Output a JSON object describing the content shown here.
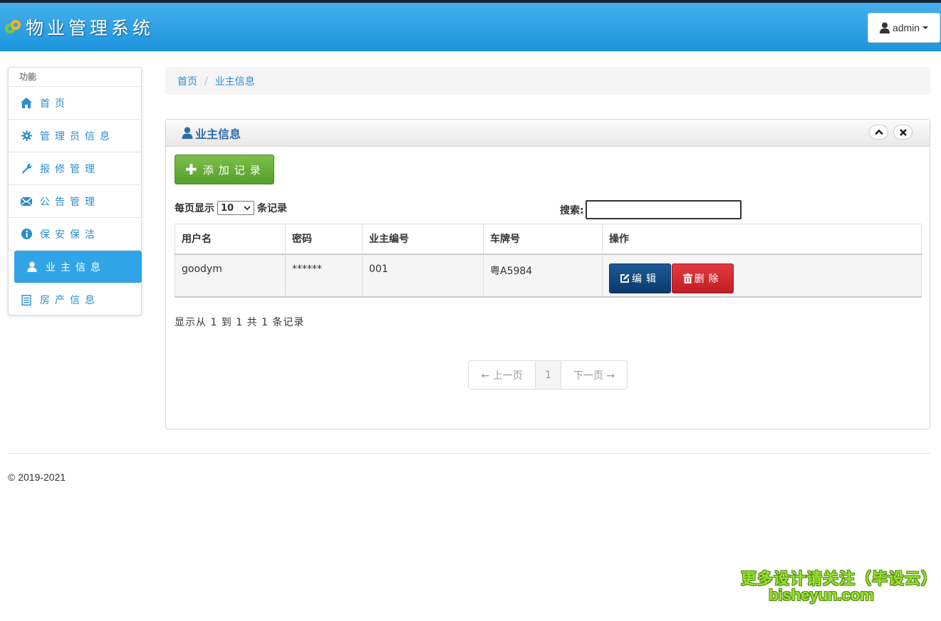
{
  "app": {
    "title": "物业管理系统"
  },
  "user": {
    "name": "admin"
  },
  "sidebar": {
    "header": "功能",
    "items": [
      {
        "label": "首页",
        "icon": "home-icon"
      },
      {
        "label": "管理员信息",
        "icon": "gear-icon"
      },
      {
        "label": "报修管理",
        "icon": "wrench-icon"
      },
      {
        "label": "公告管理",
        "icon": "envelope-icon"
      },
      {
        "label": "保安保洁",
        "icon": "info-icon"
      },
      {
        "label": "业主信息",
        "icon": "user-icon",
        "active": true
      },
      {
        "label": "房产信息",
        "icon": "list-icon"
      }
    ]
  },
  "breadcrumb": {
    "home": "首页",
    "sep": "/",
    "current": "业主信息"
  },
  "panel": {
    "title": "业主信息",
    "add_label": "添加记录",
    "length": {
      "prefix": "每页显示",
      "value": "10",
      "suffix": "条记录"
    },
    "search_label": "搜索:",
    "search_value": "",
    "columns": [
      "用户名",
      "密码",
      "业主编号",
      "车牌号",
      "操作"
    ],
    "rows": [
      {
        "username": "goodym",
        "password": "******",
        "owner_no": "001",
        "plate": "粤A5984"
      }
    ],
    "edit_label": "编辑",
    "delete_label": "删除",
    "info": "显示从 1 到 1 共 1 条记录",
    "pager": {
      "prev": "← 上一页",
      "page": "1",
      "next": "下一页 →"
    }
  },
  "footer": {
    "copyright": "© 2019-2021"
  },
  "watermark": {
    "line1": "更多设计请关注（毕设云）",
    "line2": "bisheyun.com"
  },
  "colors": {
    "navbar": "#2aa0e4",
    "accent": "#2a8ccf",
    "add": "#66ad37",
    "edit": "#0f4479",
    "delete": "#d3262c"
  }
}
